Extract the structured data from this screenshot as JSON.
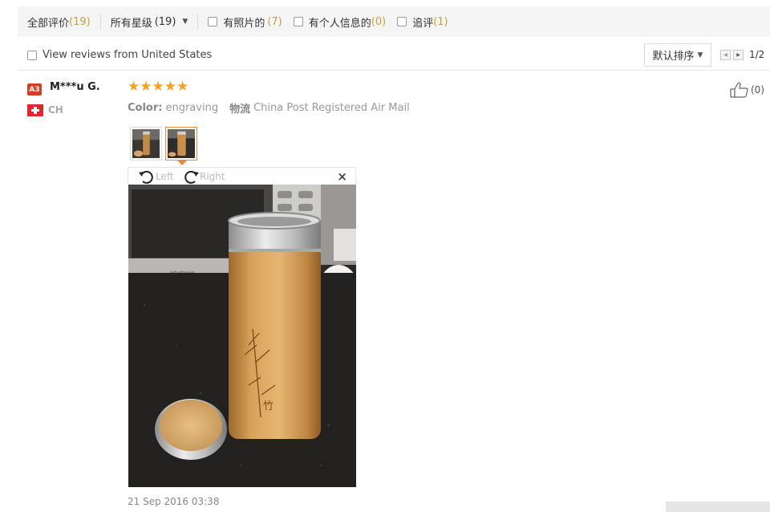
{
  "filters": {
    "all_label": "全部评价",
    "all_count": "(19)",
    "stars_label": "所有星级",
    "stars_count": "(19)",
    "photo_label": "有照片的",
    "photo_count": "(7)",
    "personal_label": "有个人信息的",
    "personal_count": "(0)",
    "followup_label": "追评",
    "followup_count": "(1)"
  },
  "options": {
    "us_reviews_label": "View reviews from United States",
    "sort_label": "默认排序",
    "page_indicator": "1/2"
  },
  "review": {
    "level_badge": "A3",
    "username": "M***u G.",
    "country": "CH",
    "rating": 5,
    "color_key": "Color:",
    "color_value": "engraving",
    "logistics_key": "物流",
    "logistics_value": "China Post Registered Air Mail",
    "likes": "(0)",
    "rotate_left": "Left",
    "rotate_right": "Right",
    "close": "×",
    "date": "21 Sep 2016 03:38"
  },
  "colors": {
    "accent_star": "#f6a01d",
    "count_gold": "#c9a13a",
    "badge_red": "#d33f24",
    "active_thumb": "#e98a3a"
  }
}
